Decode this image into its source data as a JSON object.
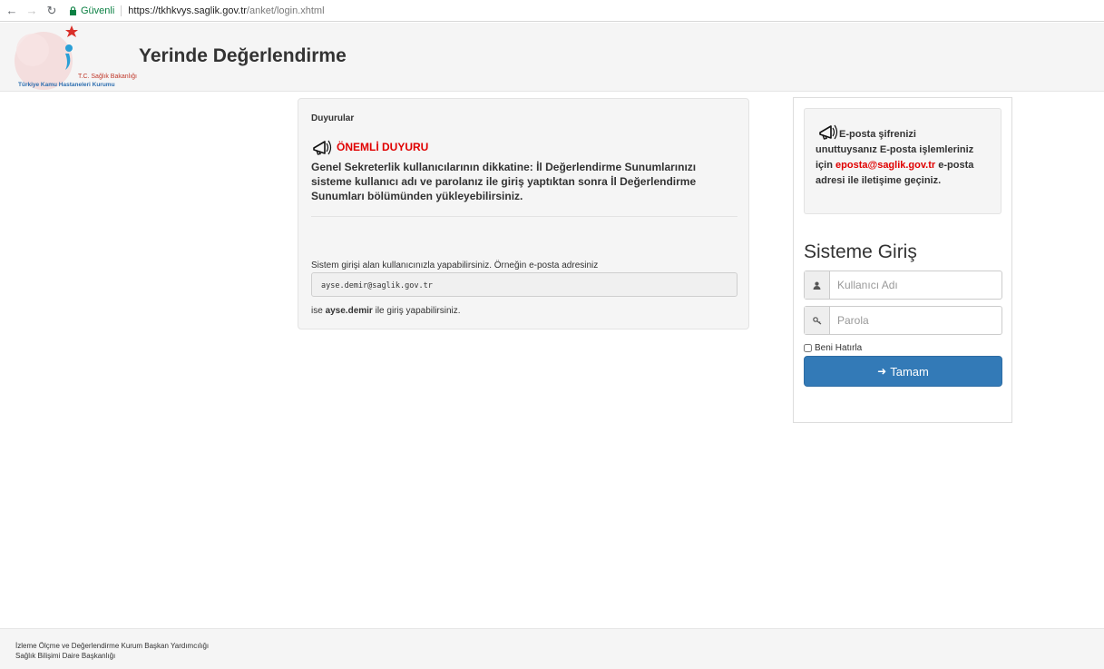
{
  "browser": {
    "back_icon": "arrow-left-icon",
    "forward_icon": "arrow-right-icon",
    "reload_icon": "reload-icon",
    "secure_label": "Güvenli",
    "url_host": "https://tkhkvys.saglik.gov.tr",
    "url_path": "/anket/login.xhtml"
  },
  "header": {
    "logo_line1": "T.C. Sağlık Bakanlığı",
    "logo_line2": "Türkiye Kamu Hastaneleri Kurumu",
    "title": "Yerinde Değerlendirme"
  },
  "announcements": {
    "title": "Duyurular",
    "important_label": "ÖNEMLİ DUYURU",
    "body": "Genel Sekreterlik kullanıcılarının dikkatine: İl Değerlendirme Sunumlarınızı sisteme kullanıcı adı ve parolanız ile giriş yaptıktan sonra İl Değerlendirme Sunumları bölümünden yükleyebilirsiniz.",
    "login_info": "Sistem girişi alan kullanıcınızla yapabilirsiniz. Örneğin e-posta adresiniz",
    "example_email": "ayse.demir@saglik.gov.tr",
    "after_prefix": "ise ",
    "after_user": "ayse.demir",
    "after_suffix": " ile giriş yapabilirsiniz."
  },
  "email_notice": {
    "line1": "E-posta şifrenizi",
    "part1": "unuttuysanız E-posta işlemleriniz için ",
    "email": "eposta@saglik.gov.tr",
    "part2": " e-posta adresi ile iletişime geçiniz."
  },
  "login": {
    "title": "Sisteme Giriş",
    "username_placeholder": "Kullanıcı Adı",
    "username_value": "",
    "password_placeholder": "Parola",
    "password_value": "",
    "remember_label": "Beni Hatırla",
    "submit_label": "Tamam"
  },
  "footer": {
    "line1": "İzleme Ölçme ve Değerlendirme Kurum Başkan Yardımcılığı",
    "line2": "Sağlık Bilişimi Daire Başkanlığı"
  },
  "colors": {
    "primary": "#337ab7",
    "important_red": "#e00000",
    "secure_green": "#0b8043"
  }
}
